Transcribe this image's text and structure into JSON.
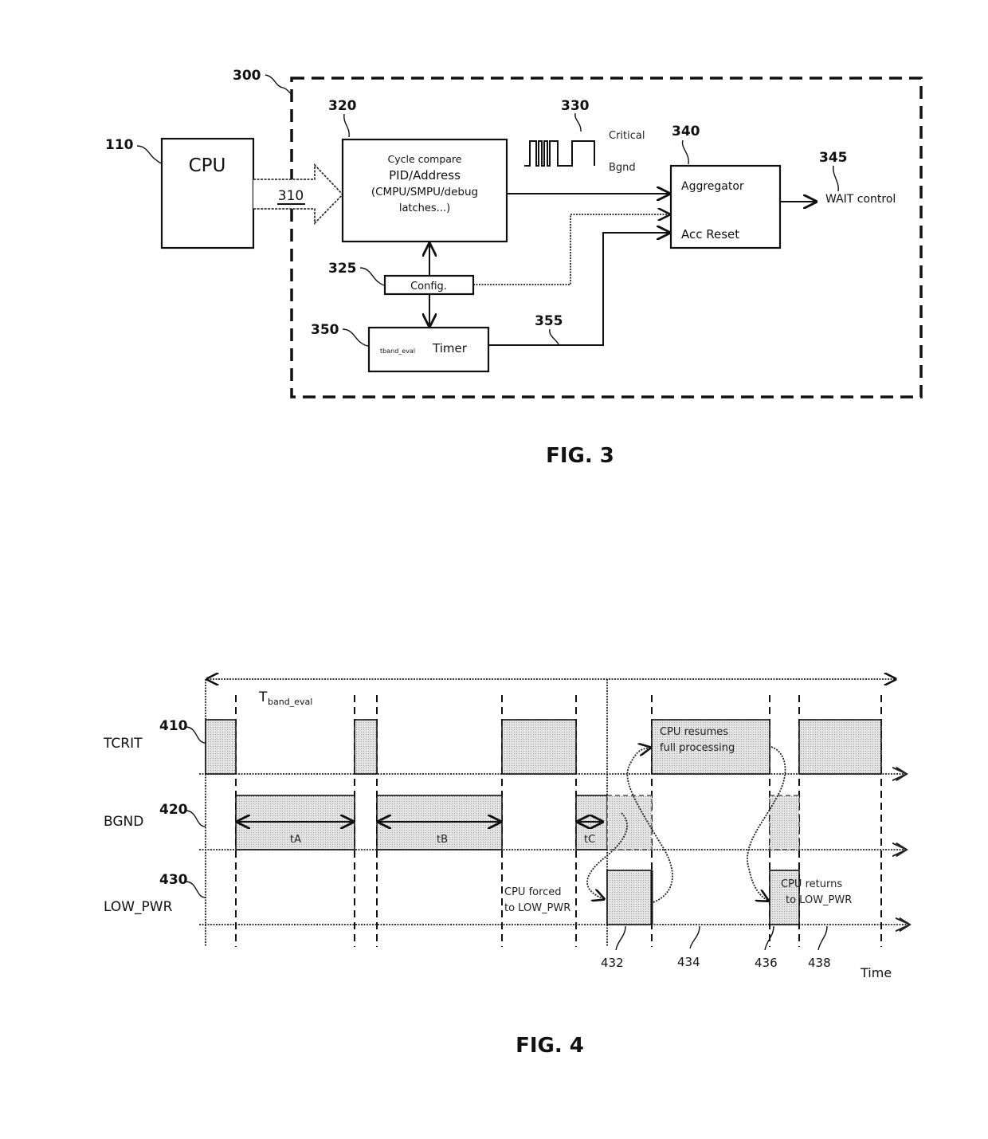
{
  "fig3": {
    "caption": "FIG. 3",
    "refs": {
      "system": "300",
      "cpu": "110",
      "bus": "310",
      "compare": "320",
      "waveform": "330",
      "config": "325",
      "aggregator": "340",
      "wait": "345",
      "timer": "350",
      "timer_line": "355"
    },
    "cpu_label": "CPU",
    "compare_lines": [
      "Cycle compare",
      "PID/Address",
      "(CMPU/SMPU/debug",
      "latches...)"
    ],
    "waveform_labels": [
      "Critical",
      "Bgnd"
    ],
    "aggregator_label": "Aggregator",
    "acc_reset_label": "Acc Reset",
    "wait_label": "WAIT control",
    "config_label": "Config.",
    "timer_sub": "tband_eval",
    "timer_label": "Timer"
  },
  "fig4": {
    "caption": "FIG. 4",
    "period_label": "T",
    "period_sub": "band_eval",
    "signals": [
      {
        "ref": "410",
        "name": "TCRIT"
      },
      {
        "ref": "420",
        "name": "BGND"
      },
      {
        "ref": "430",
        "name": "LOW_PWR"
      }
    ],
    "durations": [
      "tA",
      "tB",
      "tC"
    ],
    "annotations": {
      "resume": [
        "CPU resumes",
        "full processing"
      ],
      "forced": [
        "CPU forced",
        "to LOW_PWR"
      ],
      "returns": [
        "CPU returns",
        "to LOW_PWR"
      ]
    },
    "bottom_refs": [
      "432",
      "434",
      "436",
      "438"
    ],
    "time_label": "Time"
  }
}
